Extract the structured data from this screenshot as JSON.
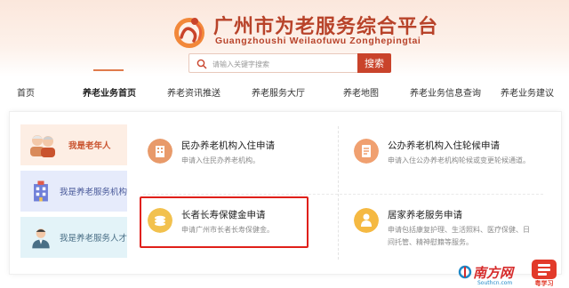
{
  "header": {
    "title": "广州市为老服务综合平台",
    "subtitle": "Guangzhoushi Weilaofuwu Zonghepingtai",
    "search": {
      "placeholder": "请输入关键字搜索",
      "button_label": "搜索"
    }
  },
  "nav": {
    "items": [
      {
        "label": "首页"
      },
      {
        "label": "养老业务首页",
        "active": true
      },
      {
        "label": "养老资讯推送"
      },
      {
        "label": "养老服务大厅"
      },
      {
        "label": "养老地图"
      },
      {
        "label": "养老业务信息查询"
      },
      {
        "label": "养老业务建议"
      }
    ]
  },
  "sidebar": {
    "tabs": [
      {
        "label": "我是老年人",
        "active": true
      },
      {
        "label": "我是养老服务机构"
      },
      {
        "label": "我是养老服务人才"
      }
    ]
  },
  "services": [
    {
      "title": "民办养老机构入住申请",
      "desc": "申请入住民办养老机构。"
    },
    {
      "title": "公办养老机构入住轮候申请",
      "desc": "申请入住公办养老机构轮候或变更轮候通道。"
    },
    {
      "title": "长者长寿保健金申请",
      "desc": "申请广州市长者长寿保健金。",
      "highlighted": true
    },
    {
      "title": "居家养老服务申请",
      "desc": "申请包括康复护理、生活照料、医疗保健、日间托管、精神慰籍等服务。"
    }
  ],
  "colors": {
    "brand": "#c9432b",
    "highlight": "#e0201a"
  },
  "watermarks": {
    "southcn_text": "南方网",
    "southcn_domain": "Southcn.com",
    "app_text": "粤学习"
  }
}
